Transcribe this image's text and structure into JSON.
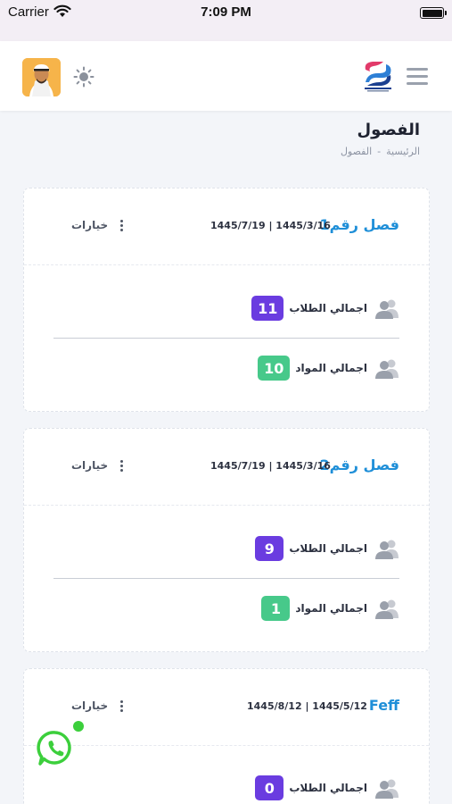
{
  "status_bar": {
    "carrier": "Carrier",
    "time": "7:09 PM"
  },
  "header": {
    "avatar_icon": "user-avatar",
    "theme_icon": "sun-icon",
    "logo_icon": "app-logo",
    "menu_icon": "hamburger-icon"
  },
  "page": {
    "title": "الفصول",
    "breadcrumb": {
      "home": "الرئيسية",
      "separator": "-",
      "current": "الفصول"
    }
  },
  "classes": [
    {
      "name": "فصل رقم1",
      "dates": "1445/7/19 | 1445/3/16",
      "options_label": "خيارات",
      "students_label": "اجمالي الطلاب",
      "students_count": "11",
      "subjects_label": "اجمالي المواد",
      "subjects_count": "10"
    },
    {
      "name": "فصل رقم2",
      "dates": "1445/7/19 | 1445/3/16",
      "options_label": "خيارات",
      "students_label": "اجمالي الطلاب",
      "students_count": "9",
      "subjects_label": "اجمالي المواد",
      "subjects_count": "1"
    },
    {
      "name": "Feff",
      "dates": "1445/8/12 | 1445/5/12",
      "options_label": "خيارات",
      "students_label": "اجمالي الطلاب",
      "students_count": "0"
    }
  ],
  "colors": {
    "accent_blue": "#1f8fd8",
    "badge_purple": "#6a3ce0",
    "badge_green": "#47c98a",
    "whatsapp_green": "#3ccf3c"
  }
}
